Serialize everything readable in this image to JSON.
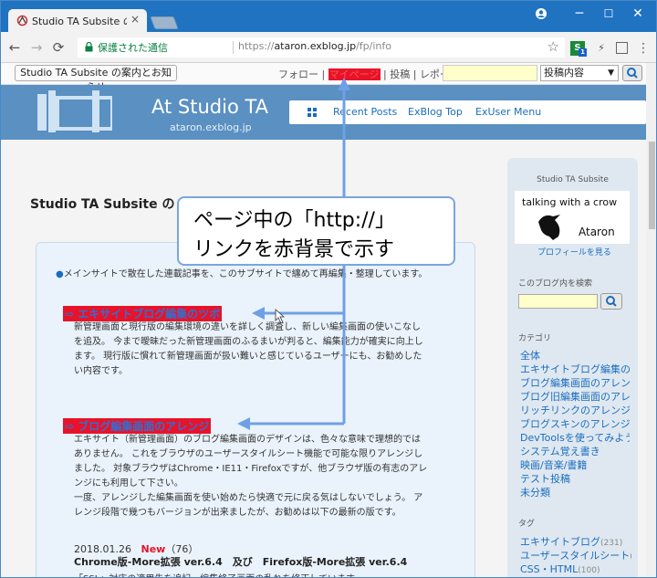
{
  "browser": {
    "tab_title": "Studio TA Subsite の案内",
    "tab_close": "×",
    "secure_label": "保護された通信",
    "url_scheme": "https://",
    "url_host": "ataron.exblog.jp",
    "url_path": "/fp/info",
    "extension_badge": "1",
    "window_min": "─",
    "window_max": "☐",
    "window_close": "✕"
  },
  "exbar": {
    "site_button": "Studio TA Subsite の案内とお知らせ",
    "link_follow": "フォロー",
    "link_mypage": "マイページ",
    "link_post": "投稿",
    "link_report": "レポート",
    "sep": "|",
    "select_value": "投稿内容"
  },
  "header": {
    "title": "At Studio TA",
    "subtitle": "ataron.exblog.jp",
    "nav_items": [
      "Recent Posts",
      "ExBlog Top",
      "ExUser Menu"
    ]
  },
  "main": {
    "title_start": "Studio TA Subsite の",
    "intro": "メインサイトで散在した連載記事を、このサブサイトで纏めて再編集・整理しています。",
    "posts": [
      {
        "heading": "⇨ エキサイトブログ編集のツボ",
        "lines": [
          "新管理画面と現行版の編集環境の違いを詳しく調査し、新しい編集画面の使いこなし",
          "を追及。 今まで曖昧だった新管理画面のふるまいが判ると、編集能力が確実に向上し",
          "ます。 現行版に慣れて新管理画面が扱い難いと感じているユーザーにも、お勧めした",
          "い内容です。"
        ]
      },
      {
        "heading": "⇨ ブログ編集画面のアレンジ",
        "lines": [
          "エキサイト（新管理画面）のブログ編集画面のデザインは、色々な意味で理想的では",
          "ありません。 これをブラウザのユーザースタイルシート機能で可能な限りアレンジし",
          "ました。 対象ブラウザはChrome・IE11・Firefoxですが、他ブラウザ版の有志のアレ",
          "ンジにも利用して下さい。",
          "一度、アレンジした編集画面を使い始めたら快適で元に戻る気はしないでしょう。 ア",
          "レンジ段階で幾つもバージョンが出来ましたが、お勧めは以下の最新の版です。"
        ]
      }
    ],
    "latest_date": "2018.01.26",
    "latest_new": "New",
    "latest_count": "（76）",
    "latest_title": "Chrome版-More拡張 ver.6.4　及び　Firefox版-More拡張 ver.6.4",
    "latest_excerpt": "「SSL」対応の適用先を追記、編集終了画面の乱れを修正しています。"
  },
  "sidebar": {
    "site_title": "Studio TA Subsite",
    "profile_text": "talking with a crow",
    "profile_name": "Ataron",
    "profile_link": "プロフィールを見る",
    "search_label": "このブログ内を検索",
    "category_label": "カテゴリ",
    "categories": [
      "全体",
      "エキサイトブログ編集のツ",
      "ブログ編集画面のアレンジ",
      "ブログ旧編集画面のアレン",
      "リッチリンクのアレンジ",
      "ブログスキンのアレンジ",
      "DevToolsを使ってみよう",
      "システム覚え書き",
      "映画/音楽/書籍",
      "テスト投稿",
      "未分類"
    ],
    "tag_label": "タグ",
    "tags": [
      {
        "name": "エキサイトブログ",
        "count": "(231)"
      },
      {
        "name": "ユーザースタイルシート",
        "count": "("
      },
      {
        "name": "CSS・HTML",
        "count": "(100)"
      }
    ]
  },
  "callout": {
    "line1": "ページ中の「http://」",
    "line2": "リンクを赤背景で示す"
  },
  "colors": {
    "accent": "#1f73c1",
    "header_bg": "#5a90c2",
    "highlight": "#e8132a",
    "link": "#1a6dbf",
    "arrow": "#6fa0e6"
  }
}
